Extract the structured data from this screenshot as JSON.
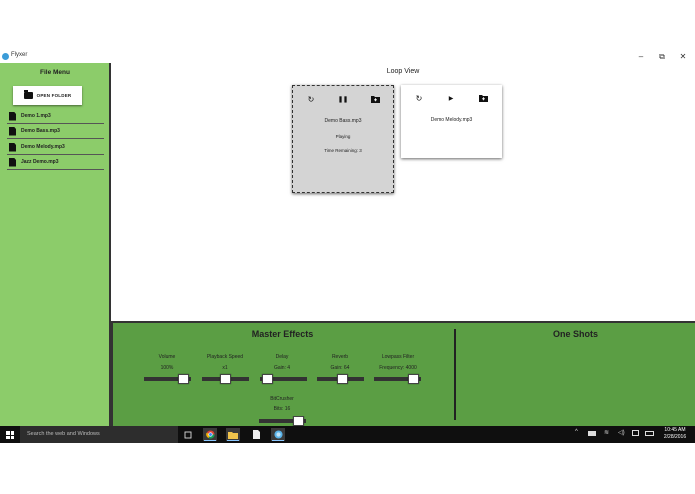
{
  "window": {
    "title": "Flyxer",
    "controls": {
      "minimize": "–",
      "restore": "⧉",
      "close": "✕"
    }
  },
  "sidebar": {
    "title": "File Menu",
    "open_folder_label": "OPEN FOLDER",
    "files": [
      "Demo 1.mp3",
      "Demo Bass.mp3",
      "Demo Melody.mp3",
      "Jazz Demo.mp3"
    ]
  },
  "loop_view": {
    "title": "Loop View",
    "cards": [
      {
        "name": "Demo Bass.mp3",
        "status": "Playing",
        "time_remaining": "Time Remaining: 3",
        "play_icon": "pause-icon"
      },
      {
        "name": "Demo Melody.mp3",
        "play_icon": "play-icon"
      }
    ]
  },
  "master_effects": {
    "title": "Master Effects",
    "controls": [
      {
        "label": "Volume",
        "value": "100%",
        "level": 0.95
      },
      {
        "label": "Playback Speed",
        "value": "x1",
        "level": 0.5
      },
      {
        "label": "Delay",
        "value": "Gain: 4",
        "level": 0.05
      },
      {
        "label": "Reverb",
        "value": "Gain: 64",
        "level": 0.55
      },
      {
        "label": "Lowpass Filter",
        "value": "Frequency: 4000",
        "level": 0.95
      },
      {
        "label": "BitCrusher",
        "value": "Bits: 16",
        "level": 0.95
      }
    ]
  },
  "one_shots": {
    "title": "One Shots"
  },
  "taskbar": {
    "search_placeholder": "Search the web and Windows",
    "time": "10:45 AM",
    "date": "2/28/2016"
  },
  "colors": {
    "sidebar_bg": "#8ccc6a",
    "effects_bg": "#5b9e44",
    "taskbar_bg": "#0f0f0f"
  }
}
